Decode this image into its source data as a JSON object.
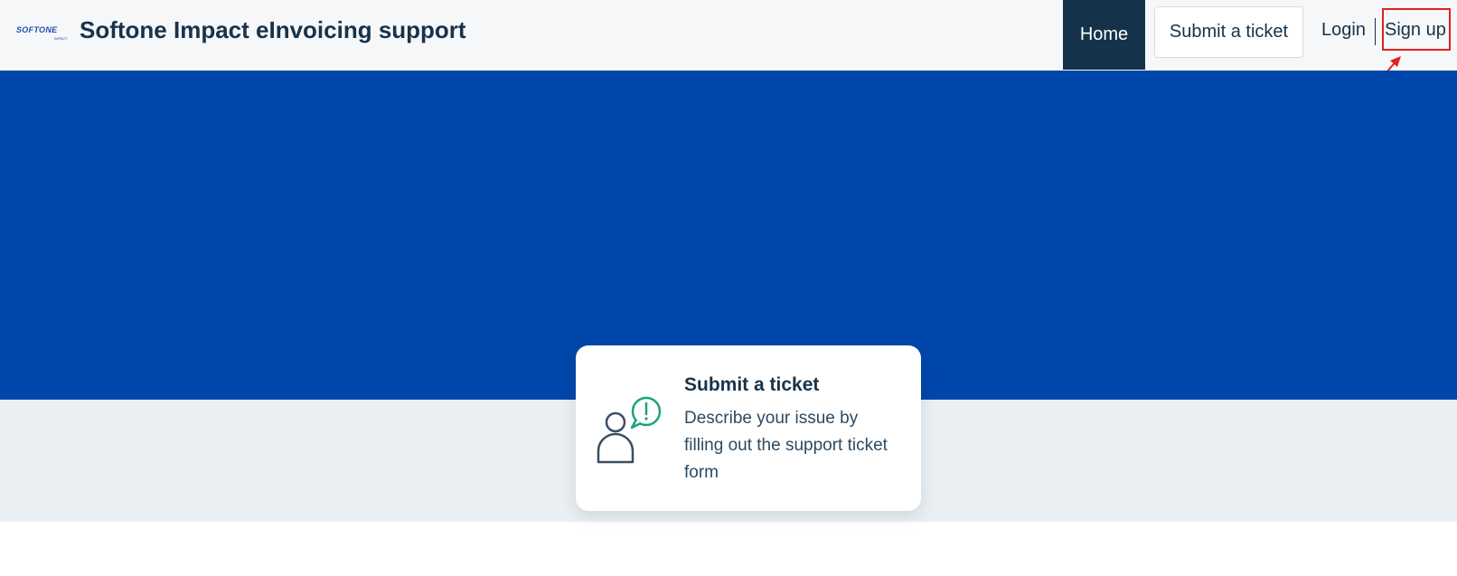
{
  "header": {
    "logo_text": "SOFTONE",
    "logo_subtext": "IMPACT",
    "site_title": "Softone Impact eInvoicing support"
  },
  "nav": {
    "home_label": "Home",
    "submit_label": "Submit a ticket",
    "login_label": "Login",
    "signup_label": "Sign up"
  },
  "card": {
    "title": "Submit a ticket",
    "description": "Describe your issue by filling out the support ticket form",
    "icon": "user-alert-icon"
  },
  "colors": {
    "header_bg": "#f5f7f9",
    "nav_active_bg": "#14334a",
    "hero_bg": "#0047ab",
    "lower_band_bg": "#e9eff2",
    "accent_green": "#1aa37a",
    "annotation_red": "#e0221f"
  }
}
